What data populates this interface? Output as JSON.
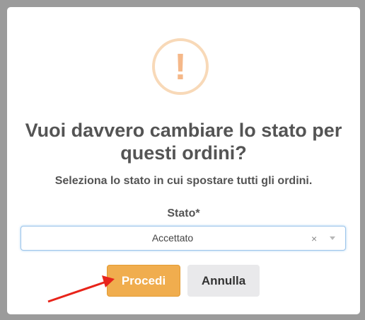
{
  "modal": {
    "icon": "warning-exclamation-icon",
    "icon_glyph": "!",
    "title": "Vuoi davvero cambiare lo stato per questi ordini?",
    "subtitle": "Seleziona lo stato in cui spostare tutti gli ordini.",
    "field_label": "Stato*",
    "select": {
      "selected_value": "Accettato",
      "clear_glyph": "×"
    },
    "buttons": {
      "confirm_label": "Procedi",
      "cancel_label": "Annulla"
    }
  },
  "annotation": {
    "arrow_color": "#e8241a"
  },
  "colors": {
    "overlay": "#9b9b9b",
    "warning": "#f5b889",
    "confirm": "#f0ad4e",
    "cancel": "#e9e9eb"
  }
}
